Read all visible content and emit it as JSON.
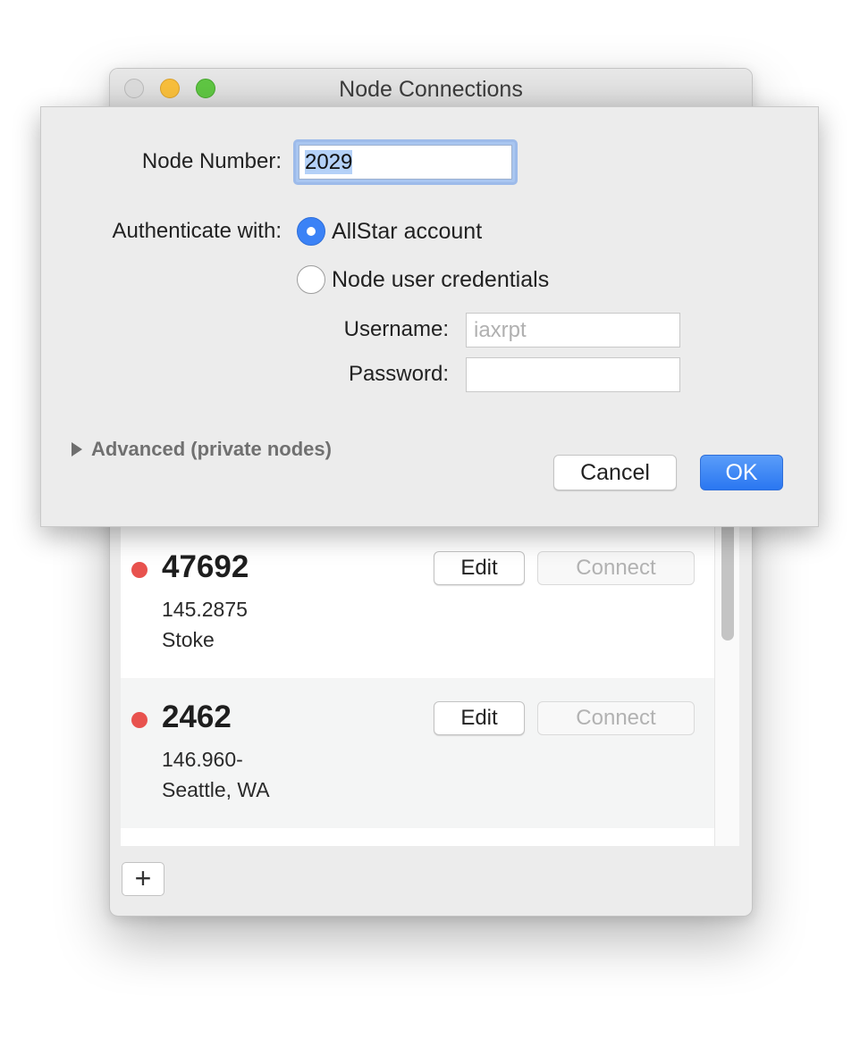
{
  "window": {
    "title": "Node Connections"
  },
  "dialog": {
    "node_number_label": "Node Number:",
    "node_number_value": "2029",
    "authenticate_label": "Authenticate with:",
    "options": {
      "allstar": "AllStar account",
      "node_credentials": "Node user credentials",
      "selected": "allstar"
    },
    "username_label": "Username:",
    "username_placeholder": "iaxrpt",
    "password_label": "Password:",
    "password_value": "",
    "advanced_label": "Advanced (private nodes)",
    "cancel_label": "Cancel",
    "ok_label": "OK"
  },
  "nodes": [
    {
      "number": "47692",
      "frequency": "145.2875",
      "location": "Stoke",
      "status": "disconnected",
      "edit_label": "Edit",
      "connect_label": "Connect"
    },
    {
      "number": "2462",
      "frequency": "146.960-",
      "location": "Seattle, WA",
      "status": "disconnected",
      "edit_label": "Edit",
      "connect_label": "Connect"
    }
  ],
  "add_button_label": "+",
  "colors": {
    "accent": "#3b82f6",
    "status_disconnected": "#e8524e",
    "selection": "#b4d1f8"
  }
}
